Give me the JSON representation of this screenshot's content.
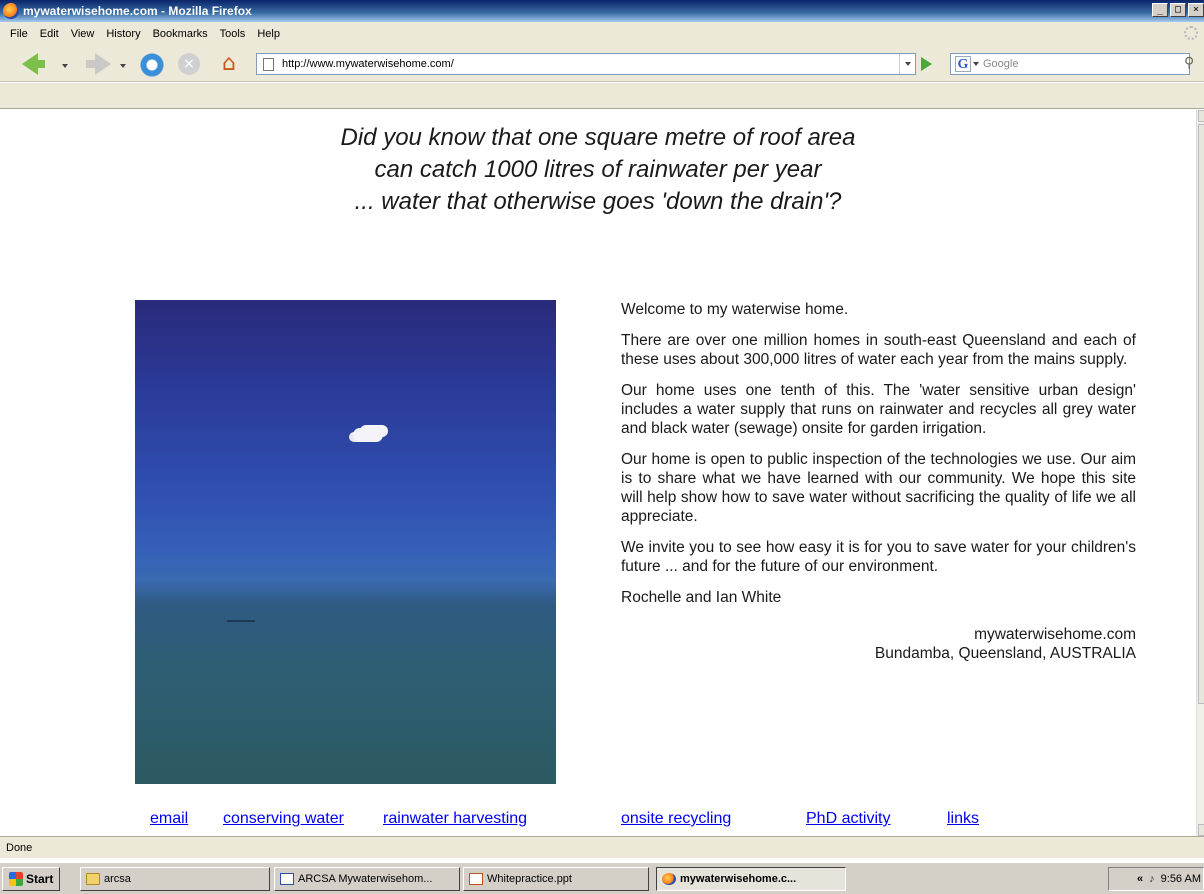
{
  "window": {
    "title": "mywaterwisehome.com - Mozilla Firefox",
    "controls": [
      "_",
      "□",
      "×"
    ]
  },
  "menu": [
    {
      "label": "File"
    },
    {
      "label": "Edit"
    },
    {
      "label": "View"
    },
    {
      "label": "History"
    },
    {
      "label": "Bookmarks"
    },
    {
      "label": "Tools"
    },
    {
      "label": "Help"
    }
  ],
  "navbar": {
    "url": "http://www.mywaterwisehome.com/",
    "search_placeholder": "Google",
    "search_engine_letter": "G"
  },
  "page": {
    "headline": [
      "Did you know that one square metre of roof area",
      "can catch 1000 litres of rainwater per year",
      "... water that otherwise goes 'down the drain'?"
    ],
    "paragraphs": [
      "Welcome to my waterwise home.",
      "There are over one million homes in south-east Queensland and each of these uses about 300,000 litres of water each year from the mains supply.",
      "Our home uses one tenth of this. The 'water sensitive urban design' includes a water supply that runs on rainwater and recycles all grey water and black water (sewage) onsite for garden irrigation.",
      "Our home is open to public inspection of the technologies we use. Our aim is to share what we have learned with our community. We hope this site will help show how to save water without sacrificing the quality of life we all appreciate.",
      "We invite you to see how easy it is for you to save water for your children's future ... and for the future of our environment.",
      "Rochelle and Ian White"
    ],
    "signoff": {
      "site": "mywaterwisehome.com",
      "location": "Bundamba, Queensland, AUSTRALIA"
    },
    "links": [
      "email",
      "conserving water",
      "rainwater harvesting",
      "onsite recycling",
      "PhD activity",
      "links"
    ]
  },
  "status": {
    "text": "Done"
  },
  "taskbar": {
    "start_label": "Start",
    "tasks": [
      {
        "label": "arcsa"
      },
      {
        "label": "ARCSA Mywaterwisehom..."
      },
      {
        "label": "Whitepractice.ppt"
      },
      {
        "label": "mywaterwisehome.c..."
      }
    ],
    "tray_chevron": "«",
    "clock": "9:56 AM"
  },
  "colors": {
    "link": "#0000ee",
    "titlebar": "#0a246a",
    "chrome": "#ece9d8"
  }
}
